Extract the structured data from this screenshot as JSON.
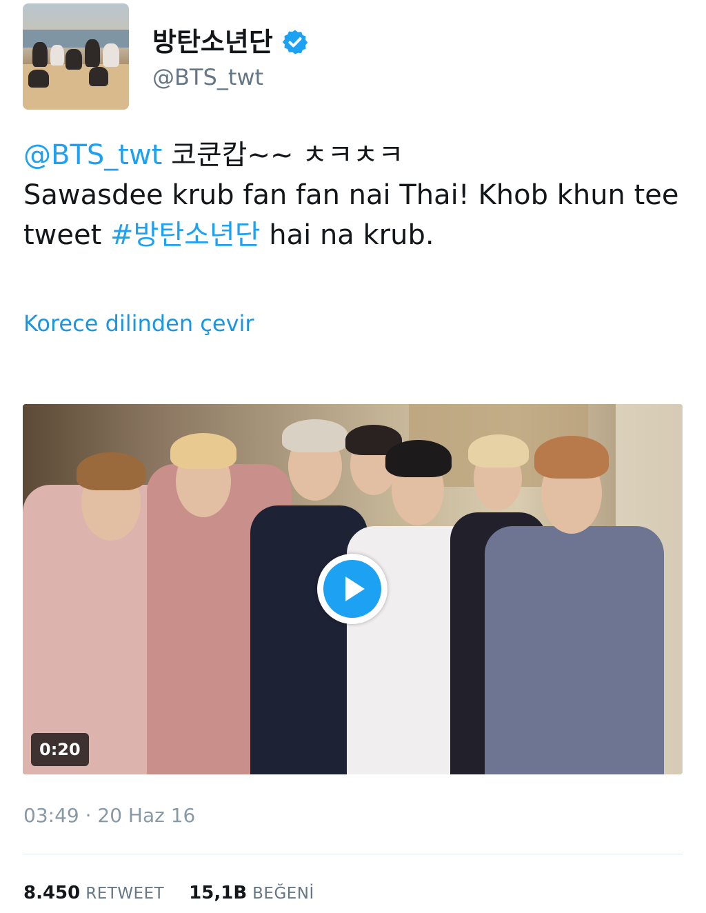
{
  "author": {
    "display_name": "방탄소년단",
    "handle": "@BTS_twt",
    "verified": true,
    "avatar_icon": "profile-photo"
  },
  "tweet": {
    "mention": "@BTS_twt",
    "line1_rest": " 코쿤캅~~ ㅊㅋㅊㅋ",
    "line2": "Sawasdee krub fan fan nai Thai! Khob khun tee",
    "line3_prefix": "tweet ",
    "hashtag": "#방탄소년단",
    "line3_suffix": " hai na krub."
  },
  "translate_link": "Korece dilinden çevir",
  "media": {
    "duration": "0:20",
    "play_icon": "play-icon"
  },
  "timestamp": "03:49 · 20 Haz 16",
  "stats": {
    "retweets_count": "8.450",
    "retweets_label": "RETWEET",
    "likes_count": "15,1B",
    "likes_label": "BEĞENİ"
  },
  "colors": {
    "link": "#1da1f2",
    "text": "#14171a",
    "secondary": "#657786",
    "divider": "#e1e8ed"
  }
}
